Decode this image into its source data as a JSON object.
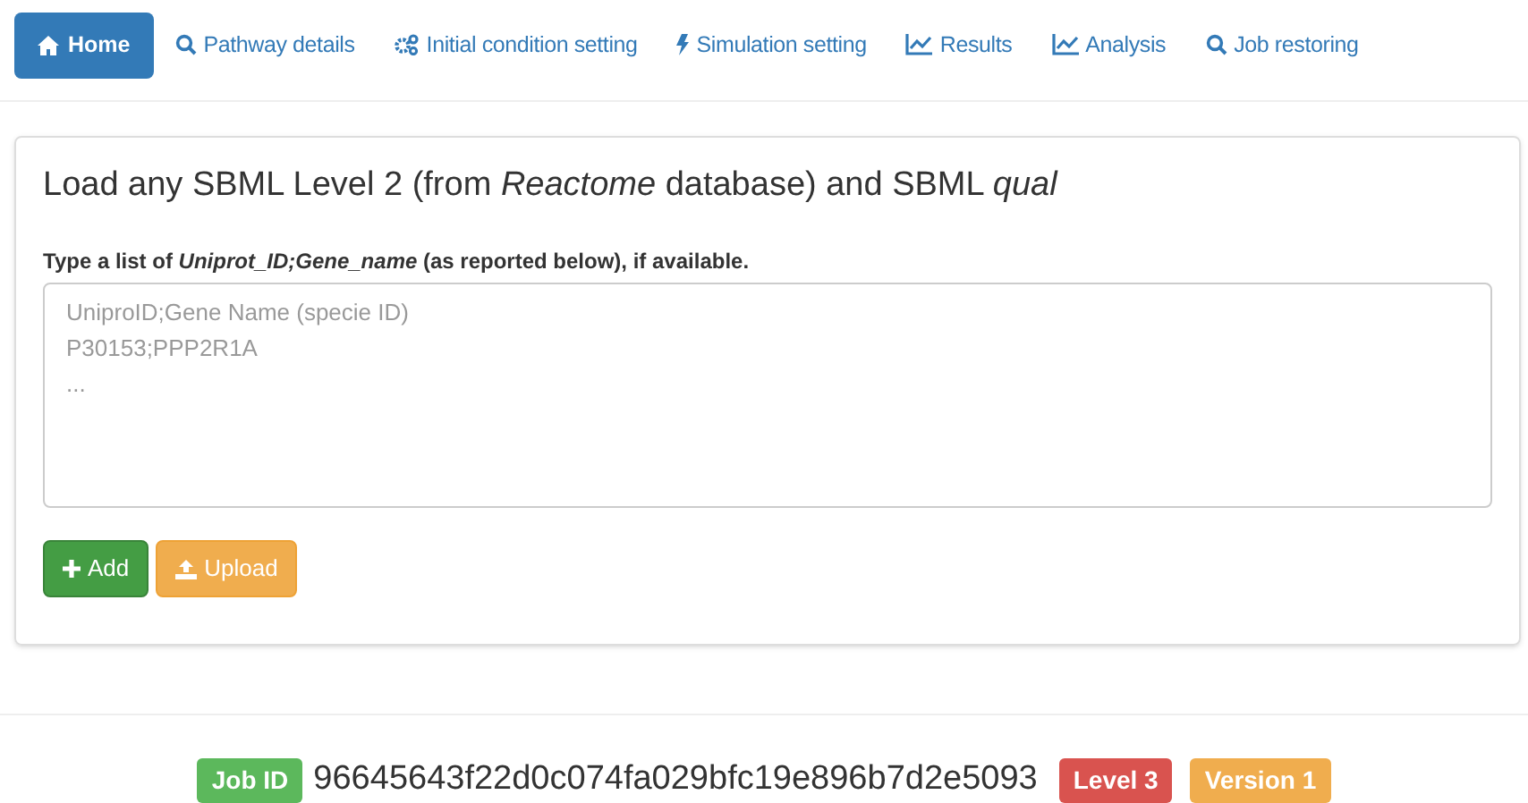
{
  "tabs": [
    {
      "label": "Home",
      "kind": "home",
      "selected": true
    },
    {
      "label": "Pathway details",
      "kind": "search",
      "selected": false
    },
    {
      "label": "Initial condition setting",
      "kind": "gears",
      "selected": false
    },
    {
      "label": "Simulation setting",
      "kind": "bolt",
      "selected": false
    },
    {
      "label": "Results",
      "kind": "chart",
      "selected": false
    },
    {
      "label": "Analysis",
      "kind": "chart",
      "selected": false
    },
    {
      "label": "Job restoring",
      "kind": "search",
      "selected": false
    }
  ],
  "panel": {
    "title": "Load any SBML Level 2 (from *Reactome* database) and SBML *qual*",
    "field_label": "Type a list of *Uniprot_ID;Gene_name* (as reported below), if available.",
    "textarea": {
      "placeholder": "UniproID;Gene Name (specie ID)\nP30153;PPP2R1A\n..."
    },
    "buttons": [
      {
        "label": "Add",
        "kind": "add"
      },
      {
        "label": "Upload",
        "kind": "upload"
      }
    ]
  },
  "footer": {
    "job_id_label": "Job ID",
    "job_id": "96645643f22d0c074fa029bfc19e896b7d2e5093",
    "badges": [
      {
        "label": "Level 3",
        "color": "#d9534f"
      },
      {
        "label": "Version 1",
        "color": "#f0ad4e"
      }
    ]
  }
}
